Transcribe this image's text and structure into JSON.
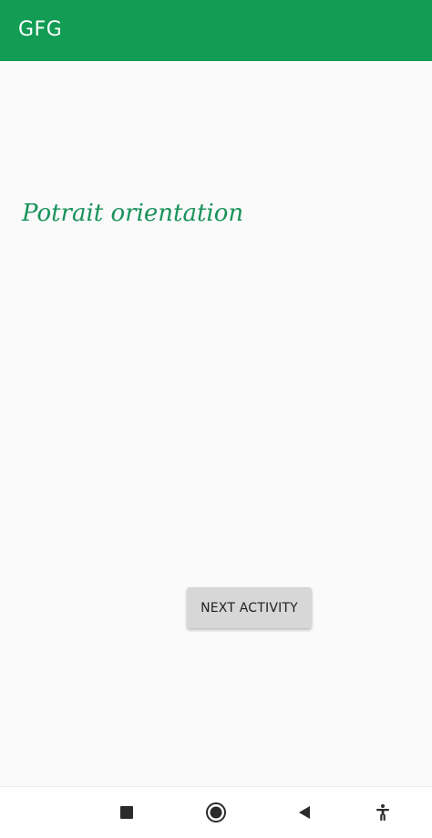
{
  "app_bar": {
    "title": "GFG",
    "color": "#129c54"
  },
  "main": {
    "orientation_text": "Potrait orientation",
    "orientation_text_color": "#18925a",
    "next_button_label": "NEXT ACTIVITY"
  },
  "nav_bar": {
    "icons": [
      "recents-square-icon",
      "home-circle-icon",
      "back-triangle-icon",
      "accessibility-icon"
    ]
  }
}
